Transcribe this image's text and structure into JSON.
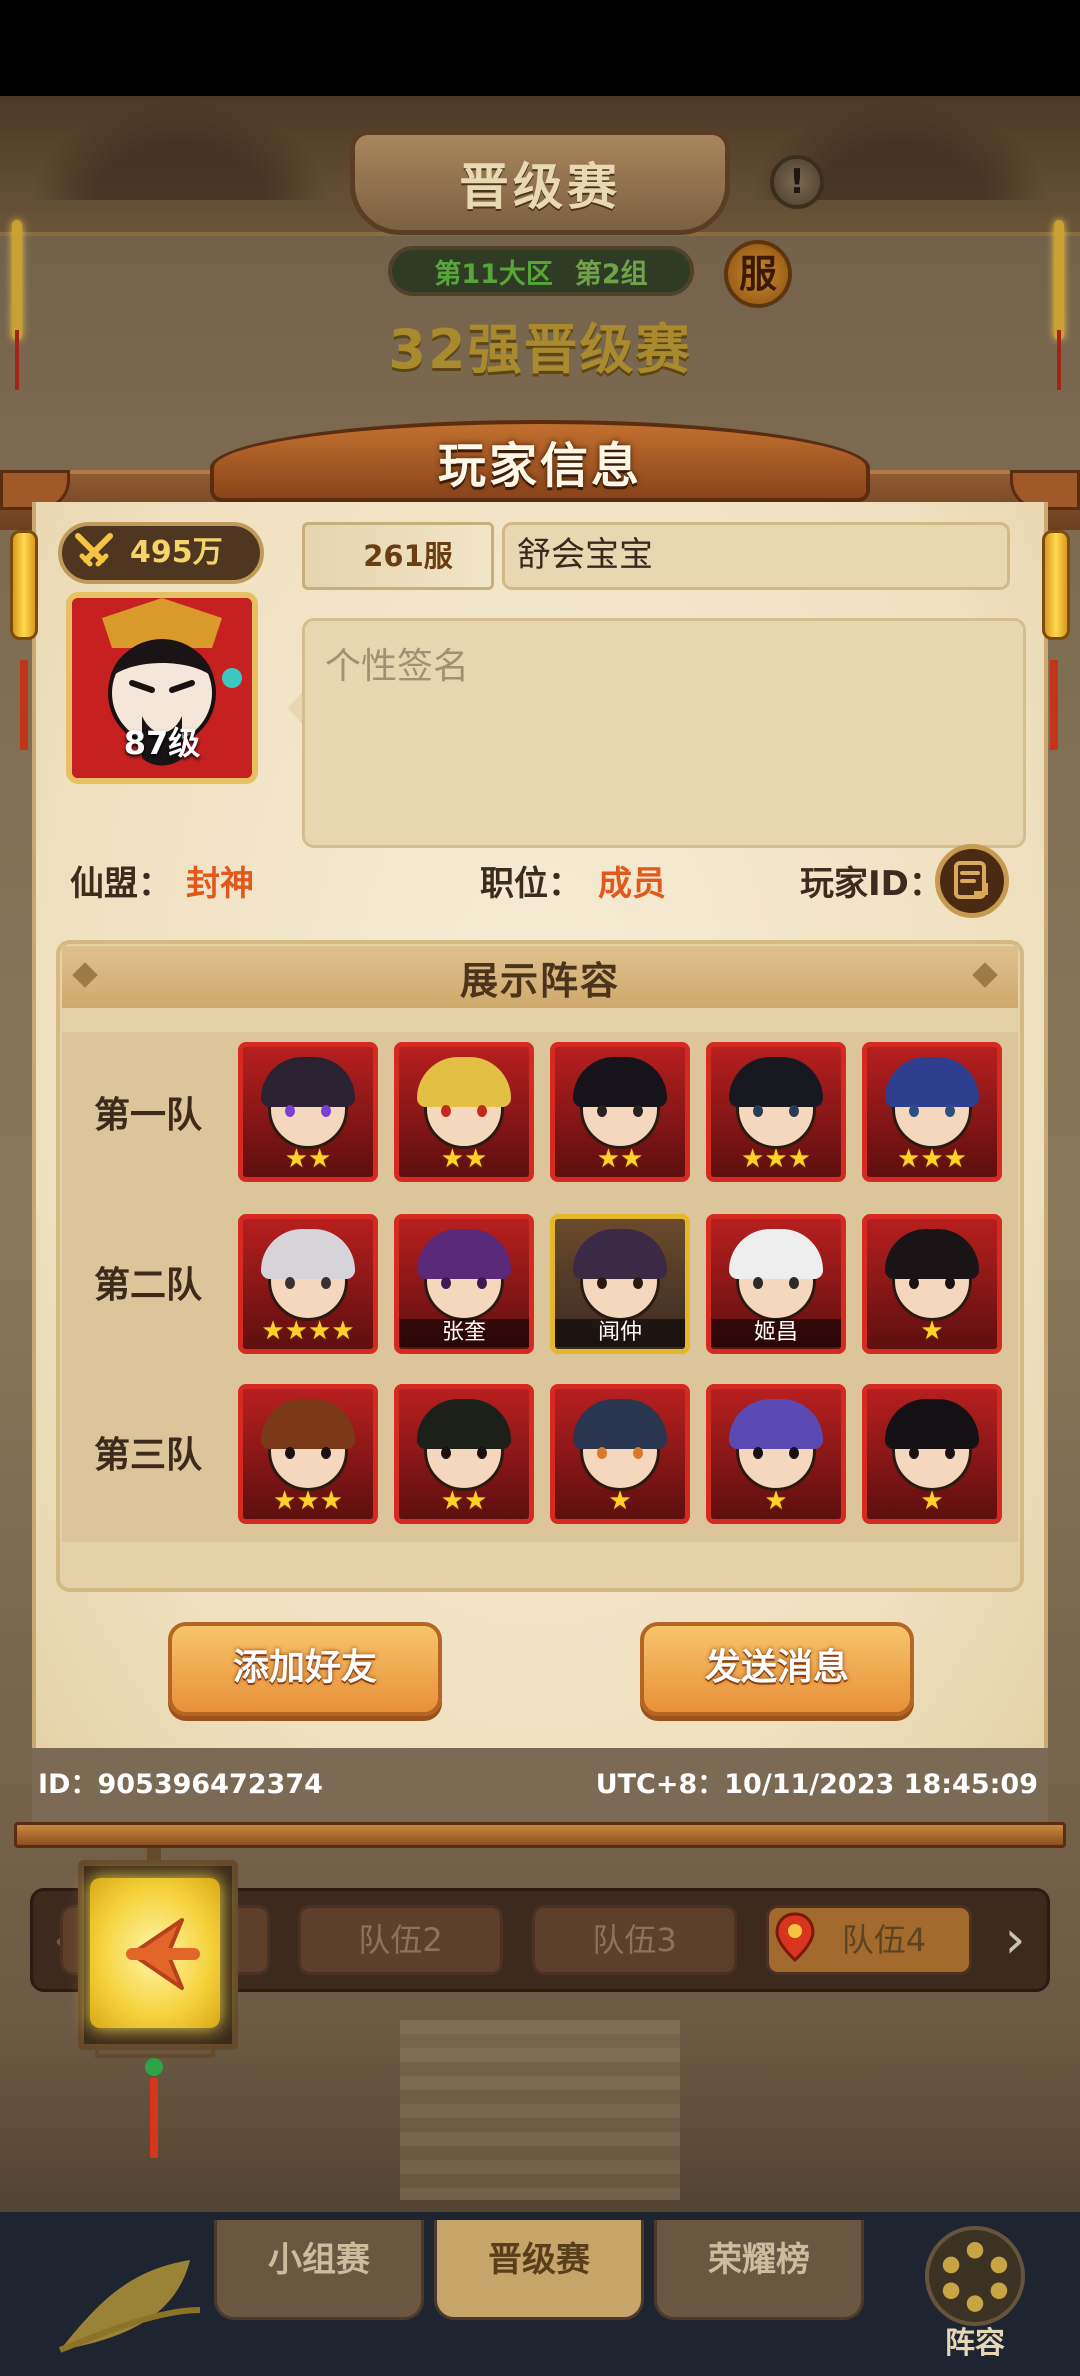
{
  "header": {
    "title": "晋级赛",
    "info_icon": "!",
    "zone": "第11大区",
    "group": "第2组",
    "server_badge": "服",
    "round_title": "32强晋级赛"
  },
  "modal": {
    "title": "玩家信息",
    "power": "495万",
    "server": "261服",
    "player_name": "舒会宝宝",
    "level": "87级",
    "signature_placeholder": "个性签名",
    "alliance_label": "仙盟：",
    "alliance_value": "封神",
    "position_label": "职位：",
    "position_value": "成员",
    "player_id_label": "玩家ID：",
    "lineup_title": "展示阵容",
    "teams": [
      {
        "label": "第一队",
        "heroes": [
          {
            "stars": "★★",
            "name": "",
            "frame": "red",
            "hair": "#2a2230",
            "eye": "#7a3fd1"
          },
          {
            "stars": "★★",
            "name": "",
            "frame": "red",
            "hair": "#e3c043",
            "eye": "#c22a1a"
          },
          {
            "stars": "★★",
            "name": "",
            "frame": "red",
            "hair": "#17131a",
            "eye": "#2a2020"
          },
          {
            "stars": "★★★",
            "name": "",
            "frame": "red",
            "hair": "#181820",
            "eye": "#2b3a55"
          },
          {
            "stars": "★★★",
            "name": "",
            "frame": "red",
            "hair": "#2f3f8f",
            "eye": "#2b4f80"
          }
        ]
      },
      {
        "label": "第二队",
        "heroes": [
          {
            "stars": "★★★★",
            "name": "",
            "frame": "red",
            "hair": "#d6d4d8",
            "eye": "#3a3030"
          },
          {
            "stars": "",
            "name": "张奎",
            "frame": "red",
            "hair": "#5a2a78",
            "eye": "#3a1a50"
          },
          {
            "stars": "",
            "name": "闻仲",
            "frame": "gold",
            "hair": "#3b2a46",
            "eye": "#2a1a10"
          },
          {
            "stars": "",
            "name": "姬昌",
            "frame": "red",
            "hair": "#eeeeee",
            "eye": "#2a2a2a"
          },
          {
            "stars": "★",
            "name": "",
            "frame": "red",
            "hair": "#1a1416",
            "eye": "#1a1010"
          }
        ]
      },
      {
        "label": "第三队",
        "heroes": [
          {
            "stars": "★★★",
            "name": "",
            "frame": "red",
            "hair": "#7a3a1a",
            "eye": "#1a1010"
          },
          {
            "stars": "★★",
            "name": "",
            "frame": "red",
            "hair": "#1d2018",
            "eye": "#1a1010"
          },
          {
            "stars": "★",
            "name": "",
            "frame": "red",
            "hair": "#2a3550",
            "eye": "#d8782a"
          },
          {
            "stars": "★",
            "name": "",
            "frame": "red",
            "hair": "#5b4ab3",
            "eye": "#1a1010"
          },
          {
            "stars": "★",
            "name": "",
            "frame": "red",
            "hair": "#141014",
            "eye": "#1a1010"
          }
        ]
      }
    ],
    "add_friend": "添加好友",
    "send_message": "发送消息",
    "footer_id": "ID：905396472374",
    "footer_time": "UTC+8：10/11/2023 18:45:09"
  },
  "team_tabs": [
    "队伍2",
    "队伍3",
    "队伍4"
  ],
  "bottom_nav": [
    "小组赛",
    "晋级赛",
    "荣耀榜"
  ],
  "lineup_label": "阵容",
  "colors": {
    "accent_orange": "#e0581c",
    "hero_frame_red": "#d42a22",
    "hero_frame_gold": "#e4b629",
    "star": "#ffd12a"
  }
}
